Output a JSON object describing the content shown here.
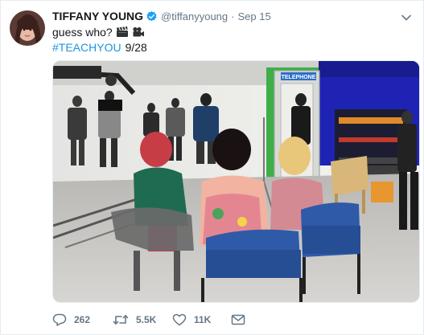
{
  "tweet": {
    "name": "TIFFANY YOUNG",
    "handle": "@tiffanyyoung",
    "separator": "·",
    "timestamp": "Sep 15",
    "text": "guess who?",
    "hashtag": "#TEACHYOU",
    "date_text": "9/28",
    "photo_sign_text": "TELEPHONE"
  },
  "actions": {
    "reply_count": "262",
    "retweet_count": "5.5K",
    "like_count": "11K"
  },
  "icons": {
    "verified": "verified-badge-icon",
    "caret": "chevron-down-icon",
    "emoji1": "clapper-board-icon",
    "emoji2": "movie-camera-icon",
    "reply": "reply-icon",
    "retweet": "retweet-icon",
    "like": "heart-icon",
    "dm": "envelope-icon"
  },
  "colors": {
    "verified_blue": "#1da1f2",
    "link_blue": "#1b95e0",
    "secondary_text": "#657786",
    "primary_text": "#14171a"
  }
}
